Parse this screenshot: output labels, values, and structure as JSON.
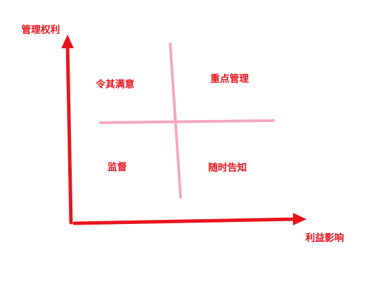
{
  "axes": {
    "y_label": "管理权利",
    "x_label": "利益影响"
  },
  "quadrants": {
    "top_left": "令其满意",
    "top_right": "重点管理",
    "bottom_left": "监督",
    "bottom_right": "随时告知"
  },
  "colors": {
    "axis": "#e8141c",
    "divider": "#f4a6c1",
    "text": "#e8141c"
  }
}
